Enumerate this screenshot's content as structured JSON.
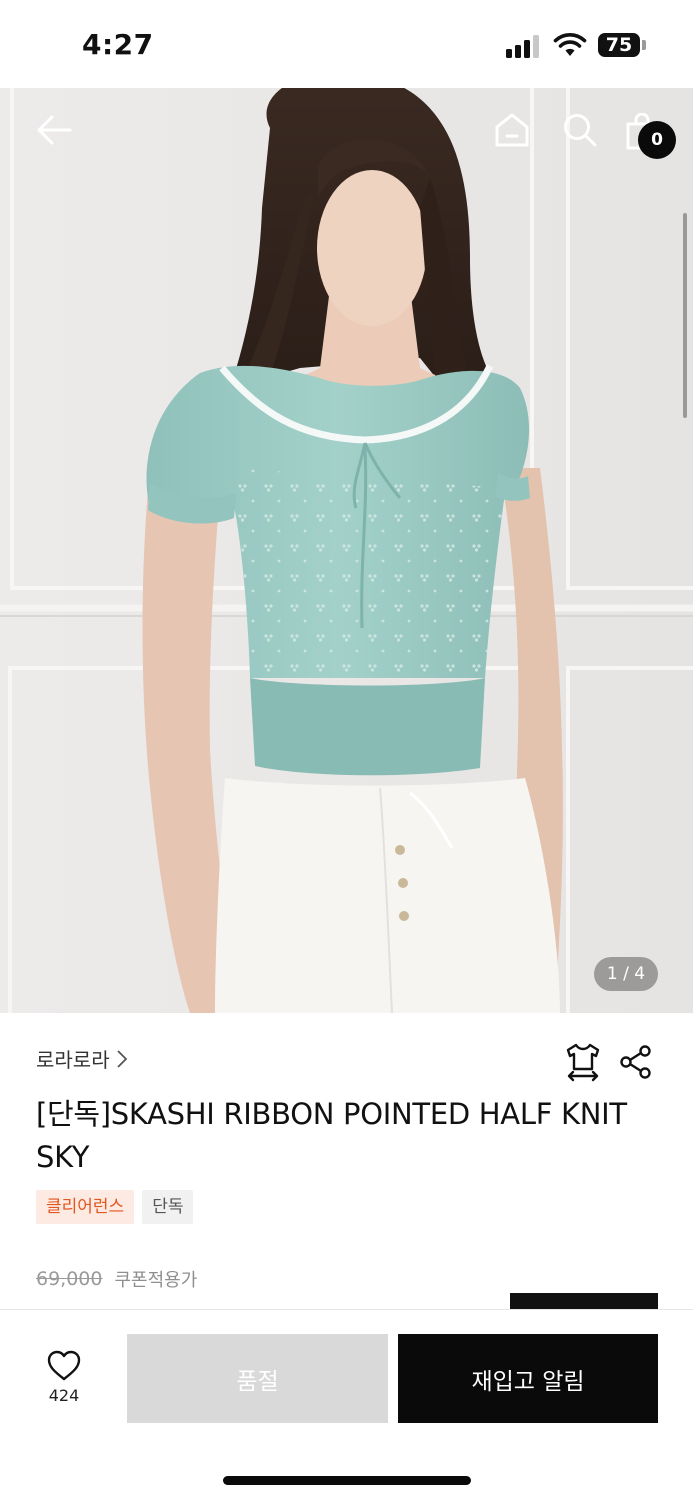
{
  "status_bar": {
    "time": "4:27",
    "battery": "75"
  },
  "header": {
    "cart_count": "0",
    "icons": [
      "back-arrow-icon",
      "home-icon",
      "search-icon",
      "shopping-bag-icon"
    ]
  },
  "gallery": {
    "counter": "1 / 4",
    "current": 1,
    "total": 4
  },
  "product": {
    "brand": "로라로라",
    "title": "[단독]SKASHI RIBBON POINTED HALF KNIT SKY",
    "tags": [
      "클리어런스",
      "단독"
    ],
    "original_price": "69,000",
    "coupon_label": "쿠폰적용가"
  },
  "bottom_bar": {
    "like_count": "424",
    "soldout_label": "품절",
    "restock_label": "재입고 알림"
  },
  "colors": {
    "accent": "#e3561f",
    "primary_button": "#0a0a0a",
    "disabled_button": "#d9d9d9",
    "knit_color": "#9ccbc4"
  }
}
